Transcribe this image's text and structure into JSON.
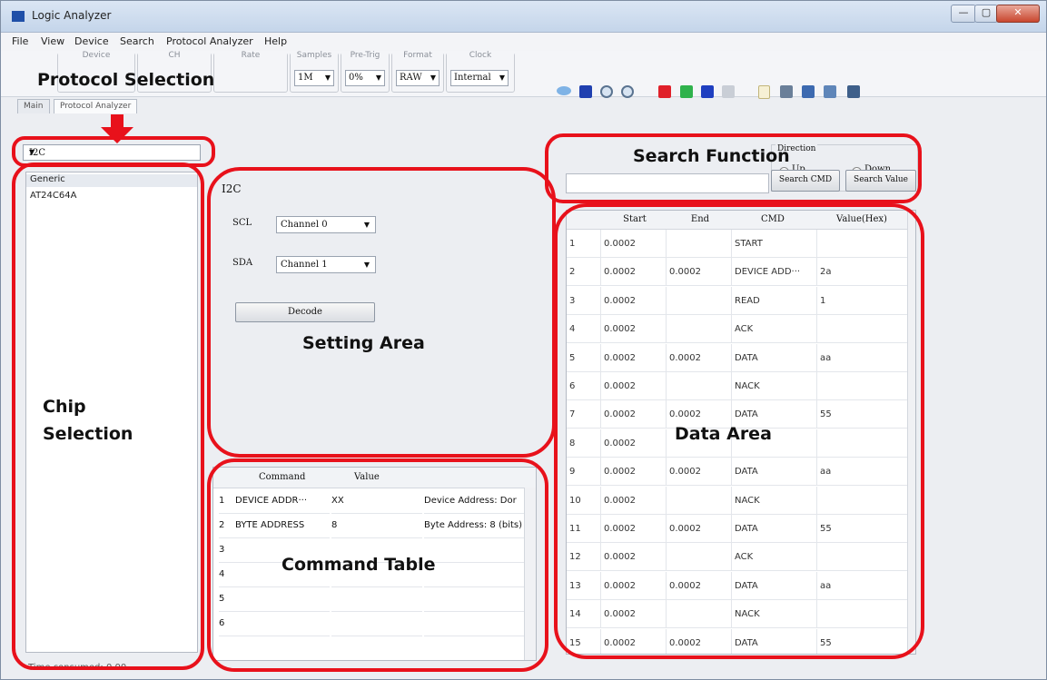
{
  "window": {
    "title": "Logic Analyzer",
    "min_glyph": "—",
    "max_glyph": "▢",
    "close_glyph": "✕"
  },
  "menu": [
    "File",
    "View",
    "Device",
    "Search",
    "Protocol Analyzer",
    "Help"
  ],
  "toolbar": {
    "groups": [
      {
        "label": "Device",
        "value": ""
      },
      {
        "label": "CH",
        "value": ""
      },
      {
        "label": "Rate",
        "value": ""
      },
      {
        "label": "Samples",
        "value": "1M"
      },
      {
        "label": "Pre-Trig",
        "value": "0%"
      },
      {
        "label": "Format",
        "value": "RAW"
      },
      {
        "label": "Clock",
        "value": "Internal"
      }
    ],
    "icons": [
      "run-icon",
      "chart-icon",
      "zoom-in-icon",
      "zoom-out-icon",
      "a-marker-icon",
      "b-marker-icon",
      "t-marker-icon",
      "note-icon",
      "new-file-icon",
      "open-icon",
      "save-icon",
      "export-icon",
      "camera-icon"
    ],
    "colors": {
      "a_marker": "#e0202a",
      "b_marker": "#2fb24c",
      "t_marker": "#1f3fc0",
      "chart": "#2040b0"
    }
  },
  "tabs": [
    "Main",
    "Protocol Analyzer"
  ],
  "protocol": {
    "selected": "I2C"
  },
  "chips": {
    "header": "Generic",
    "items": [
      "AT24C64A"
    ]
  },
  "setting": {
    "title": "I2C",
    "scl_label": "SCL",
    "scl_value": "Channel 0",
    "sda_label": "SDA",
    "sda_value": "Channel 1",
    "decode_label": "Decode"
  },
  "command_table": {
    "headers": [
      "Command",
      "Value"
    ],
    "rows": [
      {
        "no": "1",
        "command": "DEVICE ADDR···",
        "value": "XX",
        "desc": "Device Address: Dor"
      },
      {
        "no": "2",
        "command": "BYTE ADDRESS",
        "value": "8",
        "desc": "Byte Address: 8 (bits)"
      },
      {
        "no": "3",
        "command": "",
        "value": "",
        "desc": ""
      },
      {
        "no": "4",
        "command": "",
        "value": "",
        "desc": ""
      },
      {
        "no": "5",
        "command": "",
        "value": "",
        "desc": ""
      },
      {
        "no": "6",
        "command": "",
        "value": "",
        "desc": ""
      }
    ]
  },
  "search": {
    "direction_label": "Direction",
    "up_label": "Up",
    "down_label": "Down",
    "selected": "Down",
    "search_cmd_label": "Search CMD",
    "search_value_label": "Search Value",
    "query": ""
  },
  "data_table": {
    "headers": [
      "Start",
      "End",
      "CMD",
      "Value(Hex)"
    ],
    "rows": [
      {
        "no": "1",
        "start": "0.0002",
        "end": "",
        "cmd": "START",
        "value": ""
      },
      {
        "no": "2",
        "start": "0.0002",
        "end": "0.0002",
        "cmd": "DEVICE ADD···",
        "value": "2a"
      },
      {
        "no": "3",
        "start": "0.0002",
        "end": "",
        "cmd": "READ",
        "value": "1"
      },
      {
        "no": "4",
        "start": "0.0002",
        "end": "",
        "cmd": "ACK",
        "value": ""
      },
      {
        "no": "5",
        "start": "0.0002",
        "end": "0.0002",
        "cmd": "DATA",
        "value": "aa"
      },
      {
        "no": "6",
        "start": "0.0002",
        "end": "",
        "cmd": "NACK",
        "value": ""
      },
      {
        "no": "7",
        "start": "0.0002",
        "end": "0.0002",
        "cmd": "DATA",
        "value": "55"
      },
      {
        "no": "8",
        "start": "0.0002",
        "end": "",
        "cmd": "",
        "value": ""
      },
      {
        "no": "9",
        "start": "0.0002",
        "end": "0.0002",
        "cmd": "DATA",
        "value": "aa"
      },
      {
        "no": "10",
        "start": "0.0002",
        "end": "",
        "cmd": "NACK",
        "value": ""
      },
      {
        "no": "11",
        "start": "0.0002",
        "end": "0.0002",
        "cmd": "DATA",
        "value": "55"
      },
      {
        "no": "12",
        "start": "0.0002",
        "end": "",
        "cmd": "ACK",
        "value": ""
      },
      {
        "no": "13",
        "start": "0.0002",
        "end": "0.0002",
        "cmd": "DATA",
        "value": "aa"
      },
      {
        "no": "14",
        "start": "0.0002",
        "end": "",
        "cmd": "NACK",
        "value": ""
      },
      {
        "no": "15",
        "start": "0.0002",
        "end": "0.0002",
        "cmd": "DATA",
        "value": "55"
      }
    ]
  },
  "status": "Time consumed: 0.00",
  "annotations": {
    "protocol_selection": "Protocol Selection",
    "chip_selection": "Chip\nSelection",
    "setting_area": "Setting Area",
    "command_table": "Command Table",
    "search_function": "Search Function",
    "data_area": "Data Area",
    "color": "#e8111b"
  }
}
